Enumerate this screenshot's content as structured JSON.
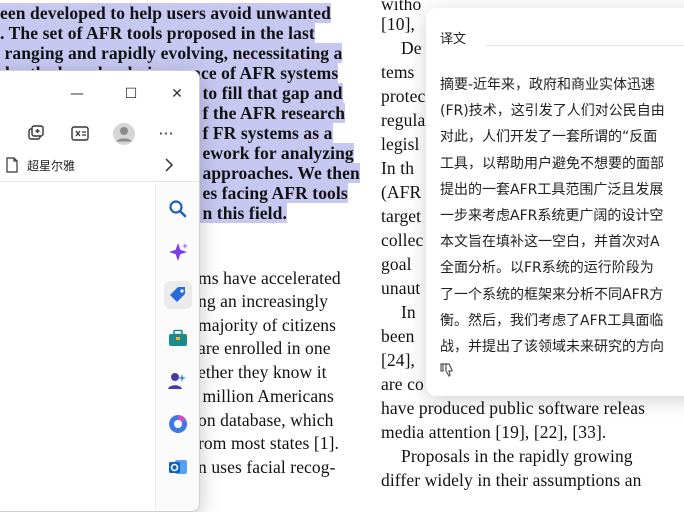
{
  "paper": {
    "left_selected_lines": [
      "een developed to help users avoid unwanted",
      ". The set of AFR tools proposed in the last",
      " ranging and rapidly evolving, necessitating a",
      "der the broader design space of AFR systems",
      " to fill that gap and",
      " f the AFR research",
      " f FR systems as a",
      " ework for analyzing",
      " approaches. We then",
      " es facing AFR tools",
      " n this field."
    ],
    "left_body_lines": [
      "ms have accelerated",
      "ng an increasingly",
      "majority of citizens",
      "are enrolled in one",
      "ether they know it",
      " million Americans",
      "on database, which",
      "rom most states [1].",
      "n uses facial recog-"
    ],
    "right_lines": [
      "witho",
      "[10],",
      "De",
      "tems",
      "protec",
      "regula",
      "legisl",
      "In th",
      "(AFR",
      "target",
      "collec",
      "goal",
      "unaut",
      "In",
      "been",
      "[24],",
      "are co",
      "have produced public software releas",
      "media attention [19], [22], [33].",
      "Proposals in the rapidly growing",
      "differ widely in their assumptions an"
    ]
  },
  "browser": {
    "title_buttons": {
      "minimize": "—",
      "maximize": "☐",
      "close": "✕"
    },
    "favorites_label": "超星尔雅",
    "toolbar_more": "···"
  },
  "translate_panel": {
    "title": "译文",
    "lines": [
      "摘要-近年来，政府和商业实体迅速",
      "(FR)技术，这引发了人们对公民自由",
      "对此，人们开发了一套所谓的“反面",
      "工具，以帮助用户避免不想要的面部",
      "提出的一套AFR工具范围广泛且发展",
      "一步来考虑AFR系统更广阔的设计空",
      "本文旨在填补这一空白，并首次对A",
      "全面分析。以FR系统的运行阶段为",
      "了一个系统的框架来分析不同AFR方",
      "衡。然后，我们考虑了AFR工具面临",
      "战，并提出了该领域未来研究的方向"
    ]
  },
  "icons": {
    "sidebar": [
      "search-icon",
      "copilot-sparkle-icon",
      "shopping-tag-icon",
      "tools-briefcase-icon",
      "games-icon",
      "microsoft-365-icon",
      "outlook-icon"
    ],
    "toolbar": [
      "tab-actions-icon",
      "reading-view-icon",
      "profile-avatar-icon",
      "more-icon"
    ]
  },
  "colors": {
    "selection": "#c7c8f2",
    "citation_highlight": "#dfe3f7",
    "accent_blue": "#2b6ad9"
  }
}
